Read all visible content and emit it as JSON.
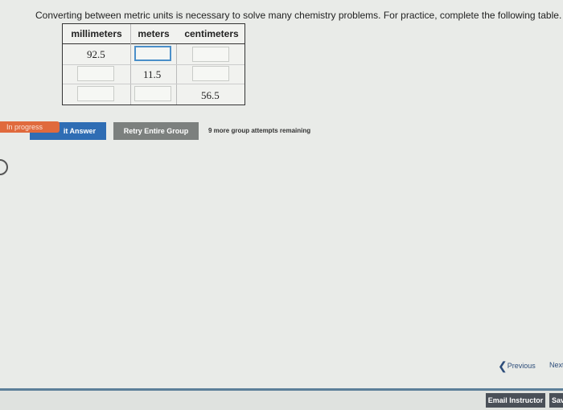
{
  "instructions": "Converting between metric units is necessary to solve many chemistry problems. For practice, complete the following table.",
  "table": {
    "headers": [
      "millimeters",
      "meters",
      "centimeters"
    ],
    "rows": [
      [
        "92.5",
        "",
        ""
      ],
      [
        "",
        "11.5",
        ""
      ],
      [
        "",
        "",
        "56.5"
      ]
    ]
  },
  "status": "In progress",
  "buttons": {
    "submit_label": "it Answer",
    "retry_label": "Retry Entire Group"
  },
  "attempts_text": "9 more group attempts remaining",
  "nav": {
    "previous_label": "Previous",
    "next_label": "Next"
  },
  "footer": {
    "email_label": "Email Instructor",
    "save_label": "Sav"
  }
}
